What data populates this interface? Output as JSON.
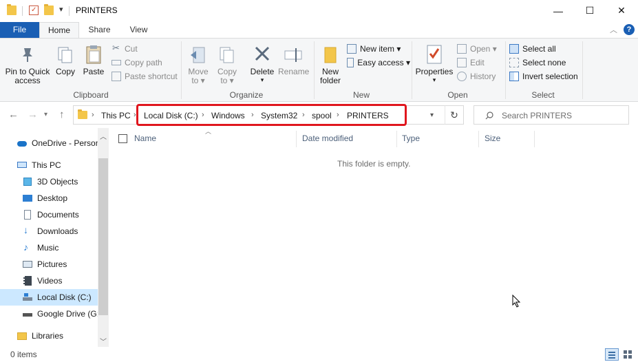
{
  "window": {
    "title": "PRINTERS",
    "controls": {
      "minimize": "—",
      "maximize": "☐",
      "close": "✕"
    }
  },
  "ribbon_tabs": [
    "File",
    "Home",
    "Share",
    "View"
  ],
  "ribbon": {
    "clipboard": {
      "label": "Clipboard",
      "pin": "Pin to Quick\naccess",
      "copy": "Copy",
      "paste": "Paste",
      "cut": "Cut",
      "copy_path": "Copy path",
      "paste_shortcut": "Paste shortcut"
    },
    "organize": {
      "label": "Organize",
      "move_to": "Move\nto ▾",
      "copy_to": "Copy\nto ▾",
      "delete": "Delete",
      "rename": "Rename"
    },
    "new": {
      "label": "New",
      "new_folder": "New\nfolder",
      "new_item": "New item ▾",
      "easy_access": "Easy access ▾"
    },
    "open": {
      "label": "Open",
      "properties": "Properties",
      "open": "Open ▾",
      "edit": "Edit",
      "history": "History"
    },
    "select": {
      "label": "Select",
      "select_all": "Select all",
      "select_none": "Select none",
      "invert": "Invert selection"
    }
  },
  "address": {
    "crumbs": [
      "This PC",
      "Local Disk (C:)",
      "Windows",
      "System32",
      "spool",
      "PRINTERS"
    ],
    "search_placeholder": "Search PRINTERS"
  },
  "nav_pane": {
    "items": [
      {
        "label": "OneDrive - Person",
        "icon": "cloud-icon"
      },
      {
        "label": "This PC",
        "icon": "pc-icon"
      },
      {
        "label": "3D Objects",
        "icon": "cube-icon"
      },
      {
        "label": "Desktop",
        "icon": "desktop-icon"
      },
      {
        "label": "Documents",
        "icon": "document-icon"
      },
      {
        "label": "Downloads",
        "icon": "download-icon"
      },
      {
        "label": "Music",
        "icon": "music-icon"
      },
      {
        "label": "Pictures",
        "icon": "picture-icon"
      },
      {
        "label": "Videos",
        "icon": "video-icon"
      },
      {
        "label": "Local Disk (C:)",
        "icon": "drive-icon"
      },
      {
        "label": "Google Drive (G:",
        "icon": "drive-icon"
      },
      {
        "label": "Libraries",
        "icon": "library-icon"
      }
    ],
    "selected": "Local Disk (C:)"
  },
  "columns": [
    "Name",
    "Date modified",
    "Type",
    "Size"
  ],
  "empty_message": "This folder is empty.",
  "status": "0 items",
  "colors": {
    "accent": "#1a5fb4",
    "highlight_box": "#e0161e",
    "selection": "#cce8ff"
  }
}
